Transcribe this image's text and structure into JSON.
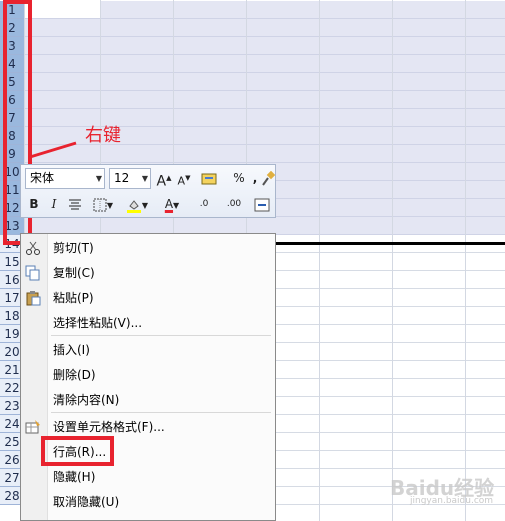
{
  "rows": [
    {
      "label": "1",
      "selected": true
    },
    {
      "label": "2",
      "selected": true
    },
    {
      "label": "3",
      "selected": true
    },
    {
      "label": "4",
      "selected": true
    },
    {
      "label": "5",
      "selected": true
    },
    {
      "label": "6",
      "selected": true
    },
    {
      "label": "7",
      "selected": true
    },
    {
      "label": "8",
      "selected": true
    },
    {
      "label": "9",
      "selected": true
    },
    {
      "label": "10",
      "selected": true
    },
    {
      "label": "11",
      "selected": true
    },
    {
      "label": "12",
      "selected": true
    },
    {
      "label": "13",
      "selected": true
    },
    {
      "label": "14",
      "selected": false
    },
    {
      "label": "15",
      "selected": false
    },
    {
      "label": "16",
      "selected": false
    },
    {
      "label": "17",
      "selected": false
    },
    {
      "label": "18",
      "selected": false
    },
    {
      "label": "19",
      "selected": false
    },
    {
      "label": "20",
      "selected": false
    },
    {
      "label": "21",
      "selected": false
    },
    {
      "label": "22",
      "selected": false
    },
    {
      "label": "23",
      "selected": false
    },
    {
      "label": "24",
      "selected": false
    },
    {
      "label": "25",
      "selected": false
    },
    {
      "label": "26",
      "selected": false
    },
    {
      "label": "27",
      "selected": false
    },
    {
      "label": "28",
      "selected": false
    }
  ],
  "annotation": {
    "text": "右键",
    "color": "#e8232f"
  },
  "toolbar": {
    "font_name": "宋体",
    "font_size": "12",
    "grow_font": "A",
    "shrink_font": "A",
    "percent": "%",
    "comma": ",",
    "bold": "B",
    "italic": "I",
    "font_color_letter": "A",
    "inc_decimal": ".0",
    "dec_decimal": ".00"
  },
  "menu": {
    "items": [
      {
        "label": "剪切(T)",
        "icon": "scissors-icon"
      },
      {
        "label": "复制(C)",
        "icon": "copy-icon"
      },
      {
        "label": "粘贴(P)",
        "icon": "paste-icon"
      },
      {
        "label": "选择性粘贴(V)...",
        "icon": ""
      },
      {
        "label": "插入(I)",
        "icon": ""
      },
      {
        "label": "删除(D)",
        "icon": ""
      },
      {
        "label": "清除内容(N)",
        "icon": ""
      },
      {
        "label": "设置单元格格式(F)...",
        "icon": "format-cells-icon"
      },
      {
        "label": "行高(R)...",
        "icon": ""
      },
      {
        "label": "隐藏(H)",
        "icon": ""
      },
      {
        "label": "取消隐藏(U)",
        "icon": ""
      }
    ]
  },
  "colors": {
    "highlight_red": "#e8232f",
    "selected_header": "#9ab8de",
    "selected_cells": "#e4e6f3"
  },
  "watermark": {
    "text": "Baidu经验",
    "sub": "jingyan.baidu.com"
  }
}
